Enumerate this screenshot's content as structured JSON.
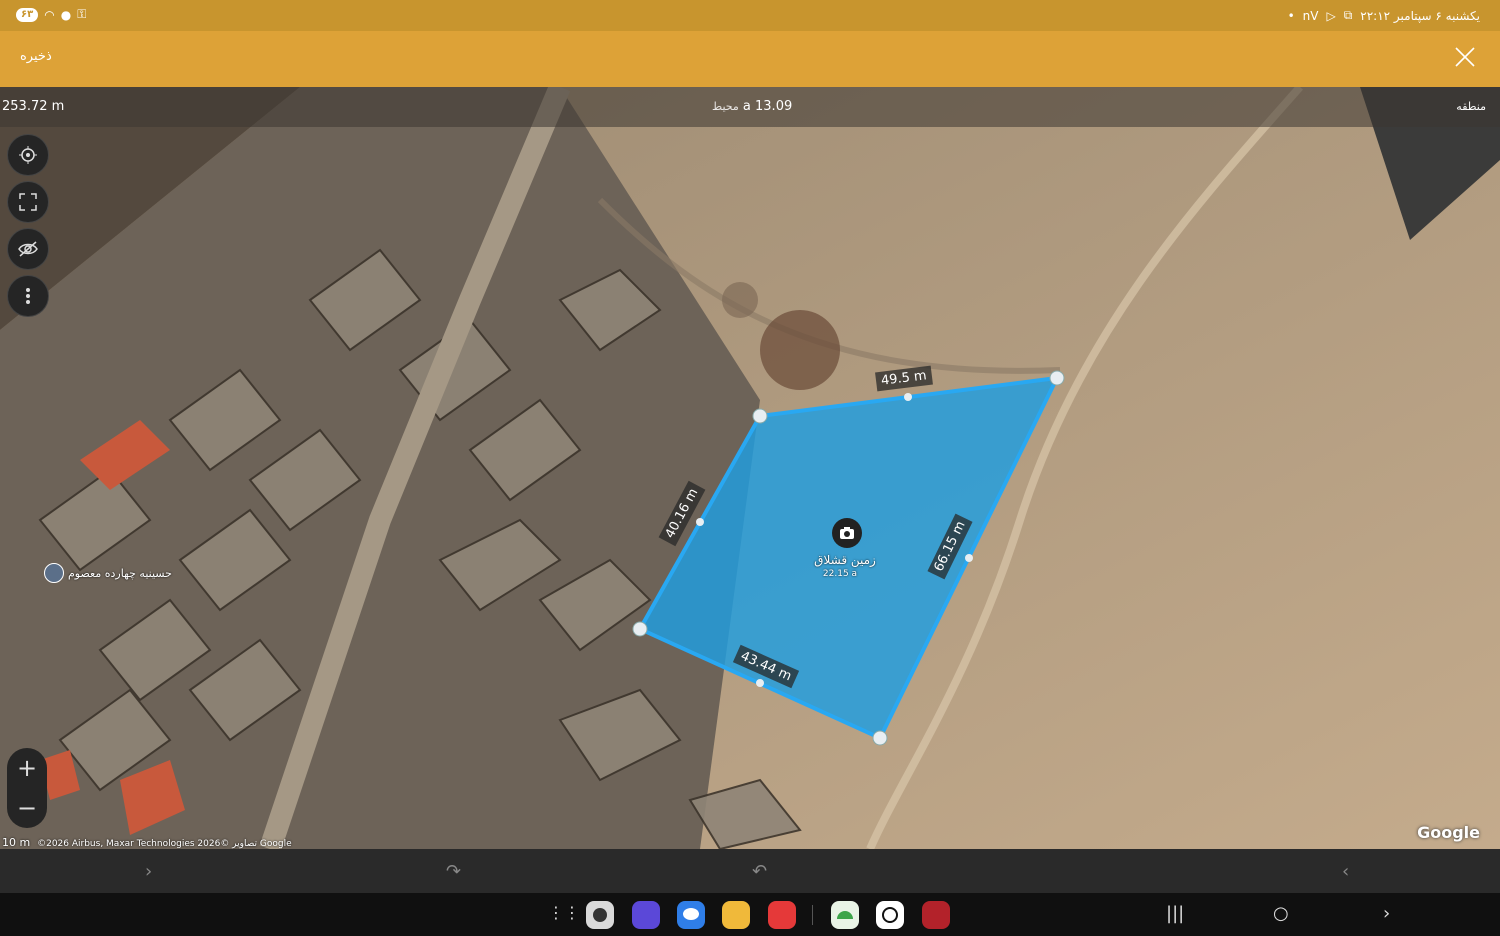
{
  "status_bar": {
    "datetime": "یکشنبه ۶ سپتامبر  ۲۲:۱۲",
    "battery": "۶۳",
    "icons": [
      "dot-icon",
      "nv-icon",
      "play-icon",
      "screenshot-icon",
      "wifi-icon",
      "location-icon",
      "key-icon"
    ],
    "nv_label": "nV"
  },
  "app_bar": {
    "save_label": "ذخیره",
    "close_icon": "close-icon",
    "background": "#dda237"
  },
  "measure_bar": {
    "perimeter_value": "253.72 m",
    "area_value": "13.09 a",
    "perimeter_label": "محیط",
    "area_label": "منطقه"
  },
  "map": {
    "controls": [
      "locate-icon",
      "fullscreen-icon",
      "hide-icon",
      "more-icon"
    ],
    "zoom_in": "+",
    "zoom_out": "−",
    "edge_labels": [
      "49.5 m",
      "40.16 m",
      "66.15 m",
      "43.44 m"
    ],
    "parcel_name": "زمین قشلاق",
    "parcel_area": "22.15 a",
    "poi_label": "حسینیه چهارده معصوم",
    "attribution": "©2026 Airbus, Maxar Technologies تصاویر ©2026 Google",
    "scale": "10 m",
    "google_logo": "Google",
    "polygon_color": "#1e9ee0"
  },
  "toolbar": {
    "icons": [
      "forward-icon",
      "redo-icon",
      "undo-icon",
      "back-icon"
    ]
  },
  "nav_bar": {
    "dock_apps": [
      "apps-grid-icon",
      "camera-app",
      "browser-app",
      "messages-app",
      "files-app",
      "notes-app",
      "android-app",
      "chatgpt-app",
      "map-app"
    ],
    "buttons": [
      "recents-button",
      "home-button",
      "back-button"
    ]
  }
}
